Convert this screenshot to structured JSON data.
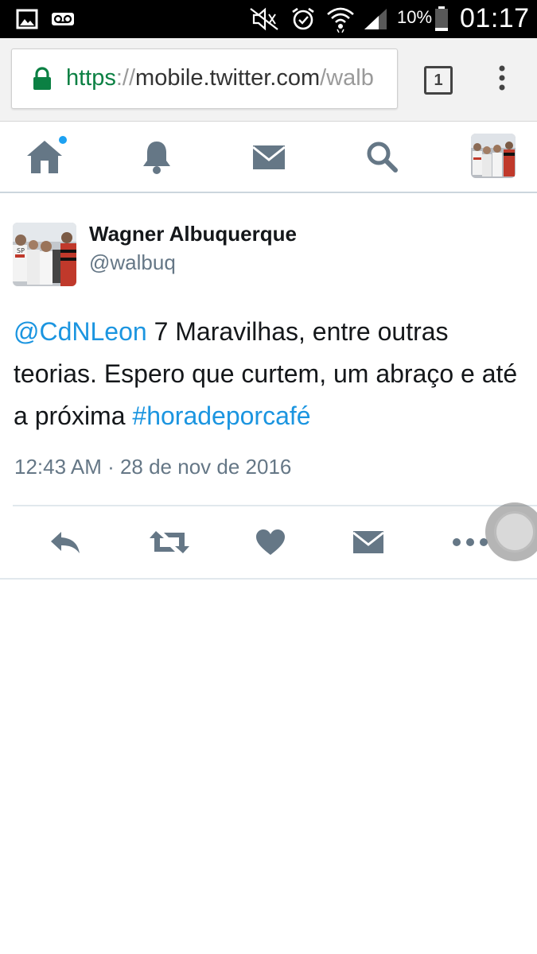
{
  "status_bar": {
    "battery_percent": "10%",
    "time": "01:17",
    "icons": [
      "image-icon",
      "voicemail-icon",
      "mute-icon",
      "alarm-icon",
      "wifi-icon",
      "signal-icon",
      "battery-icon"
    ]
  },
  "browser": {
    "url_scheme": "https",
    "url_separator": "://",
    "url_host": "mobile.twitter.com",
    "url_path": "/walb",
    "tab_count": "1",
    "secure_color": "#0b8043"
  },
  "nav": {
    "items": [
      "home-icon",
      "notifications-icon",
      "messages-icon",
      "search-icon",
      "profile-avatar"
    ],
    "has_notification": true,
    "accent": "#1da1f2"
  },
  "tweet": {
    "author_name": "Wagner Albuquerque",
    "author_handle": "@walbuq",
    "mention": "@CdNLeon",
    "text_part1": " 7 Maravilhas, entre outras teorias. Espero que curtem, um abraço e até a próxima ",
    "hashtag": "#horadeporcafé",
    "timestamp": "12:43 AM · 28 de nov de 2016",
    "link_color": "#1b95e0",
    "actions": [
      "reply-icon",
      "retweet-icon",
      "like-icon",
      "direct-message-icon",
      "more-icon"
    ]
  }
}
